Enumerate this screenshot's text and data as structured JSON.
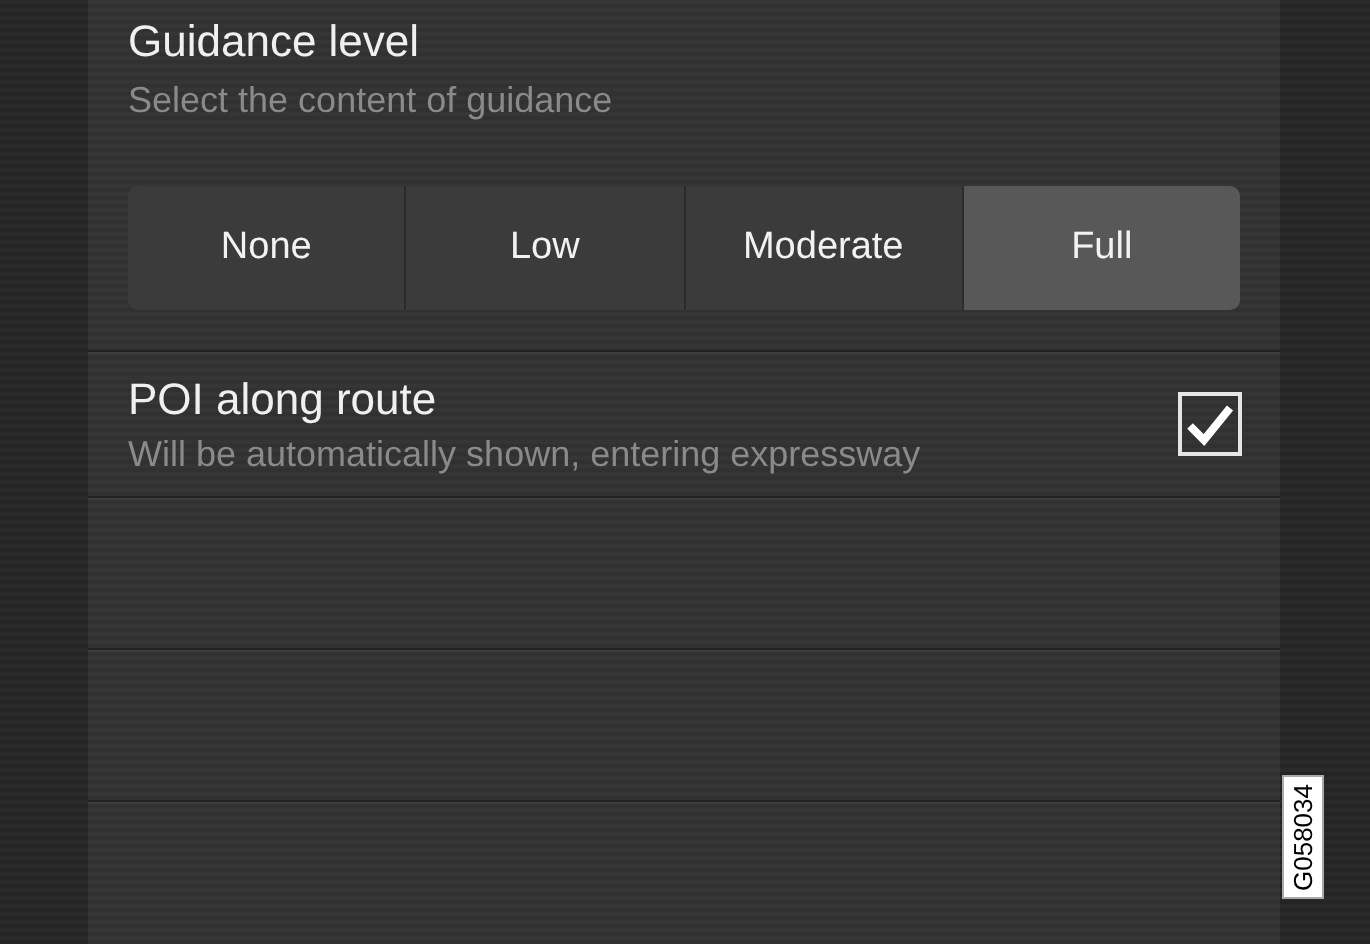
{
  "guidance": {
    "title": "Guidance level",
    "subtitle": "Select the content of guidance",
    "options": [
      {
        "label": "None",
        "selected": false
      },
      {
        "label": "Low",
        "selected": false
      },
      {
        "label": "Moderate",
        "selected": false
      },
      {
        "label": "Full",
        "selected": true
      }
    ]
  },
  "poi": {
    "title": "POI along route",
    "subtitle": "Will be automatically shown, entering expressway",
    "checked": true
  },
  "figure_id": "G058034"
}
